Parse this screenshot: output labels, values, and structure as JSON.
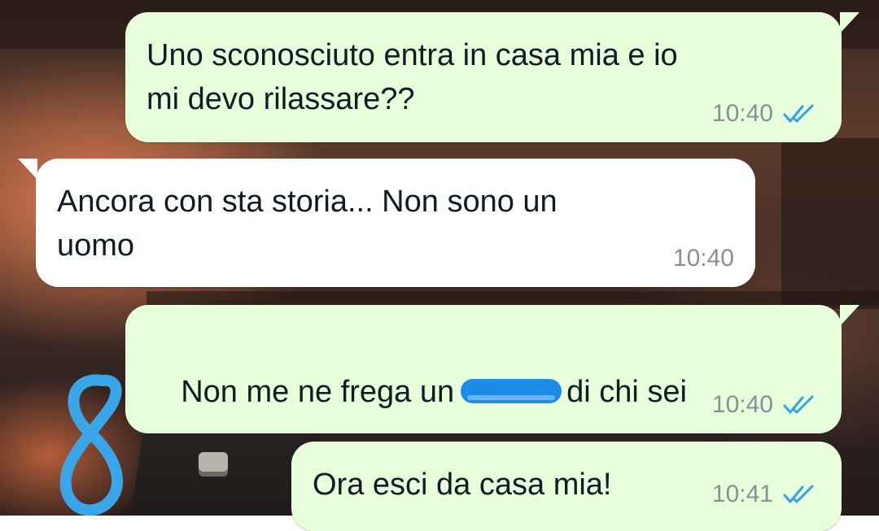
{
  "theme": {
    "outgoing_bubble": "#e7ffdb",
    "incoming_bubble": "#ffffff",
    "text": "#111b21",
    "time": "#8a8f93",
    "read_ticks": "#34a0e8",
    "annotation_color": "#3aa6e8",
    "censor_color": "#1c8ce8"
  },
  "messages": [
    {
      "direction": "outgoing",
      "text": "Uno sconosciuto entra in casa mia e io\nmi devo rilassare??",
      "time": "10:40",
      "status_icon": "double-check-read-icon"
    },
    {
      "direction": "incoming",
      "text": "Ancora con sta storia... Non sono un\nuomo",
      "time": "10:40"
    },
    {
      "direction": "outgoing",
      "text_before": "Non me ne frega un",
      "censored_icon": "censor-scribble",
      "text_after": "di chi sei",
      "time": "10:40",
      "status_icon": "double-check-read-icon"
    },
    {
      "direction": "outgoing",
      "text": "Ora esci da casa mia!",
      "time": "10:41",
      "status_icon": "double-check-read-icon"
    }
  ],
  "annotation": {
    "text": "8",
    "icon": "handwritten-number-annotation"
  },
  "background": {
    "icon": "city-sunset-wallpaper"
  }
}
